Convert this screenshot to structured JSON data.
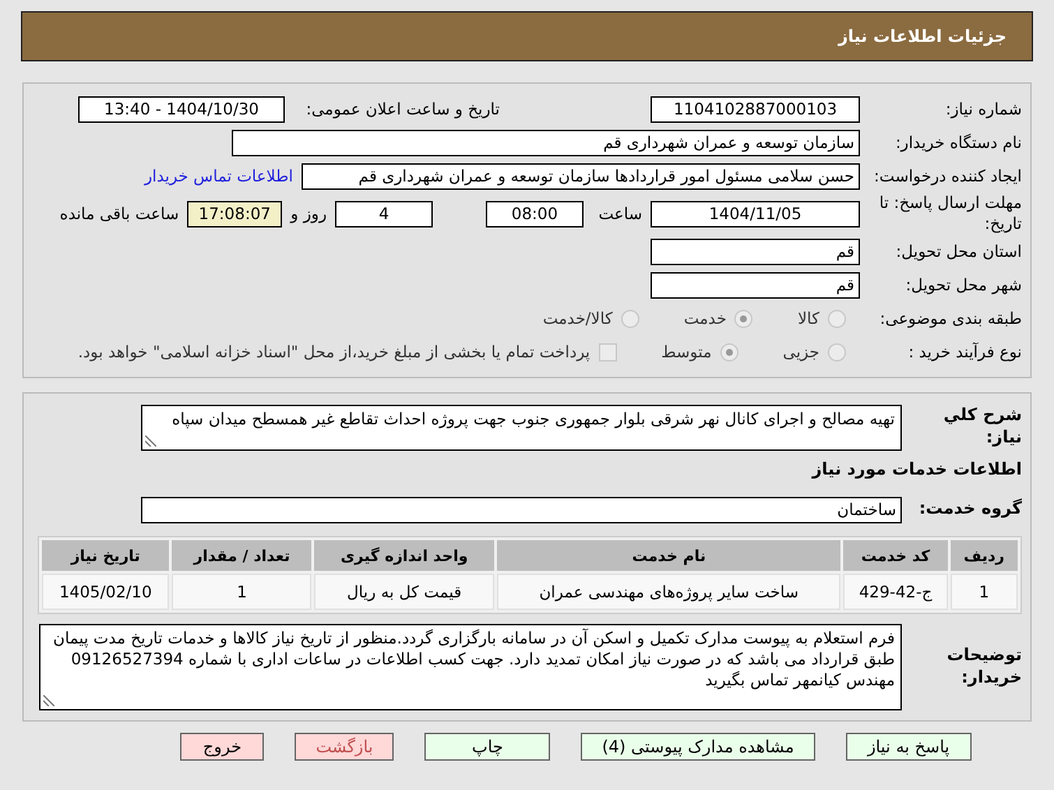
{
  "header": {
    "title": "جزئیات اطلاعات نیاز"
  },
  "need_number": {
    "label": "شماره نیاز:",
    "value": "1104102887000103"
  },
  "announce": {
    "label": "تاریخ و ساعت اعلان عمومی:",
    "value": "1404/10/30 - 13:40"
  },
  "buyer": {
    "label": "نام دستگاه خریدار:",
    "value": "سازمان توسعه و عمران شهرداری قم"
  },
  "requester": {
    "label": "ایجاد کننده درخواست:",
    "value": "حسن سلامی مسئول امور قراردادها سازمان توسعه و عمران شهرداری قم",
    "link": "اطلاعات تماس خریدار"
  },
  "deadline": {
    "label": "مهلت ارسال پاسخ: تا تاریخ:",
    "date": "1404/11/05",
    "time_label": "ساعت",
    "time": "08:00",
    "days": "4",
    "days_suffix": "روز و",
    "remaining": "17:08:07",
    "remaining_suffix": "ساعت باقی مانده"
  },
  "province": {
    "label": "استان محل تحویل:",
    "value": "قم"
  },
  "city": {
    "label": "شهر محل تحویل:",
    "value": "قم"
  },
  "category": {
    "label": "طبقه بندی موضوعی:",
    "options": [
      {
        "label": "کالا",
        "selected": false,
        "disabled": true
      },
      {
        "label": "خدمت",
        "selected": true,
        "disabled": true
      },
      {
        "label": "کالا/خدمت",
        "selected": false,
        "disabled": true
      }
    ]
  },
  "process": {
    "label": "نوع فرآیند خرید :",
    "options": [
      {
        "label": "جزیی",
        "selected": false,
        "disabled": true
      },
      {
        "label": "متوسط",
        "selected": true,
        "disabled": true
      }
    ],
    "checkbox": {
      "checked": false,
      "disabled": true,
      "text": "پرداخت تمام یا بخشی از مبلغ خرید،از محل \"اسناد خزانه اسلامی\" خواهد بود."
    }
  },
  "summary": {
    "label": "شرح کلي نياز:",
    "value": "تهیه مصالح و اجرای کانال نهر شرقی بلوار جمهوری جنوب جهت پروژه احداث تقاطع غیر همسطح میدان سپاه"
  },
  "services_heading": "اطلاعات خدمات مورد نیاز",
  "service_group": {
    "label": "گروه خدمت:",
    "value": "ساختمان"
  },
  "table": {
    "columns": [
      "ردیف",
      "کد خدمت",
      "نام خدمت",
      "واحد اندازه گیری",
      "تعداد / مقدار",
      "تاریخ نیاز"
    ],
    "rows": [
      [
        "1",
        "ج-42-429",
        "ساخت سایر پروژه‌های مهندسی عمران",
        "قیمت کل به ریال",
        "1",
        "1405/02/10"
      ]
    ]
  },
  "buyer_notes": {
    "label": "توضیحات خریدار:",
    "value": "فرم استعلام به پیوست مدارک تکمیل و اسکن آن در سامانه بارگزاری گردد.منظور از تاریخ نیاز کالاها و خدمات تاریخ مدت پیمان طبق قرارداد می باشد که در صورت نیاز امکان تمدید دارد. جهت کسب اطلاعات در ساعات اداری با شماره 09126527394 مهندس کیانمهر تماس بگیرید"
  },
  "buttons": [
    {
      "label": "پاسخ به نیاز",
      "kind": "normal"
    },
    {
      "label": "مشاهده مدارک پیوستی (4)",
      "kind": "normal"
    },
    {
      "label": "چاپ",
      "kind": "normal"
    },
    {
      "label": "بازگشت",
      "kind": "back"
    },
    {
      "label": "خروج",
      "kind": "exit"
    }
  ]
}
